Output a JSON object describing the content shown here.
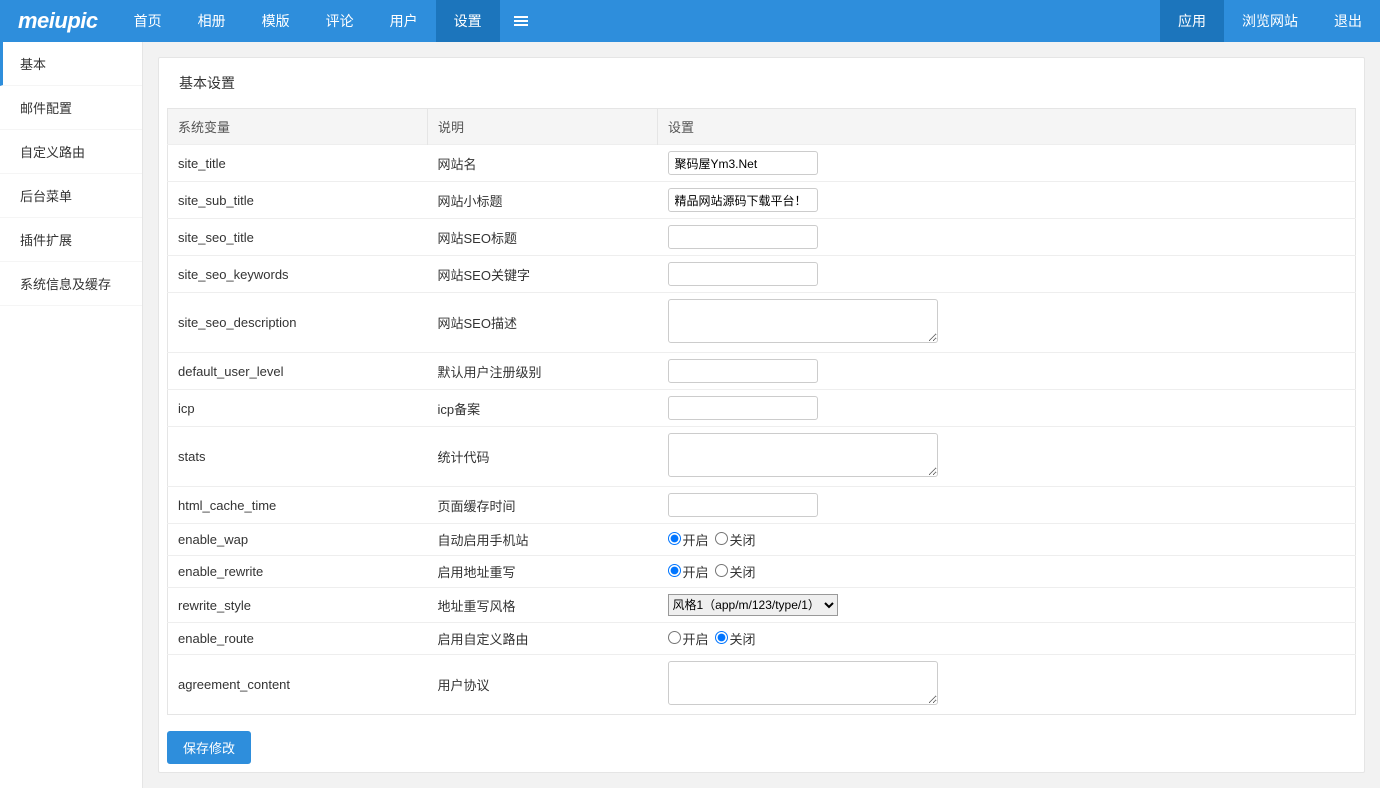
{
  "logo": "meiupic",
  "topnav": {
    "items": [
      {
        "label": "首页"
      },
      {
        "label": "相册"
      },
      {
        "label": "模版"
      },
      {
        "label": "评论"
      },
      {
        "label": "用户"
      },
      {
        "label": "设置",
        "active": true
      }
    ],
    "right": [
      {
        "label": "应用",
        "active": true
      },
      {
        "label": "浏览网站"
      },
      {
        "label": "退出"
      }
    ]
  },
  "sidebar": {
    "items": [
      {
        "label": "基本",
        "active": true
      },
      {
        "label": "邮件配置"
      },
      {
        "label": "自定义路由"
      },
      {
        "label": "后台菜单"
      },
      {
        "label": "插件扩展"
      },
      {
        "label": "系统信息及缓存"
      }
    ]
  },
  "panel_title": "基本设置",
  "table": {
    "headers": {
      "var": "系统变量",
      "desc": "说明",
      "setting": "设置"
    },
    "rows": [
      {
        "var": "site_title",
        "desc": "网站名",
        "type": "text",
        "value": "聚码屋Ym3.Net"
      },
      {
        "var": "site_sub_title",
        "desc": "网站小标题",
        "type": "text",
        "value": "精品网站源码下载平台！"
      },
      {
        "var": "site_seo_title",
        "desc": "网站SEO标题",
        "type": "text",
        "value": ""
      },
      {
        "var": "site_seo_keywords",
        "desc": "网站SEO关键字",
        "type": "text",
        "value": ""
      },
      {
        "var": "site_seo_description",
        "desc": "网站SEO描述",
        "type": "textarea",
        "value": ""
      },
      {
        "var": "default_user_level",
        "desc": "默认用户注册级别",
        "type": "text",
        "value": ""
      },
      {
        "var": "icp",
        "desc": "icp备案",
        "type": "text",
        "value": ""
      },
      {
        "var": "stats",
        "desc": "统计代码",
        "type": "textarea",
        "value": ""
      },
      {
        "var": "html_cache_time",
        "desc": "页面缓存时间",
        "type": "text",
        "value": ""
      },
      {
        "var": "enable_wap",
        "desc": "自动启用手机站",
        "type": "radio",
        "value": "on"
      },
      {
        "var": "enable_rewrite",
        "desc": "启用地址重写",
        "type": "radio",
        "value": "on"
      },
      {
        "var": "rewrite_style",
        "desc": "地址重写风格",
        "type": "select",
        "value": "风格1（app/m/123/type/1）"
      },
      {
        "var": "enable_route",
        "desc": "启用自定义路由",
        "type": "radio",
        "value": "off"
      },
      {
        "var": "agreement_content",
        "desc": "用户协议",
        "type": "textarea",
        "value": ""
      }
    ]
  },
  "radio_labels": {
    "on": "开启",
    "off": "关闭"
  },
  "save_label": "保存修改"
}
